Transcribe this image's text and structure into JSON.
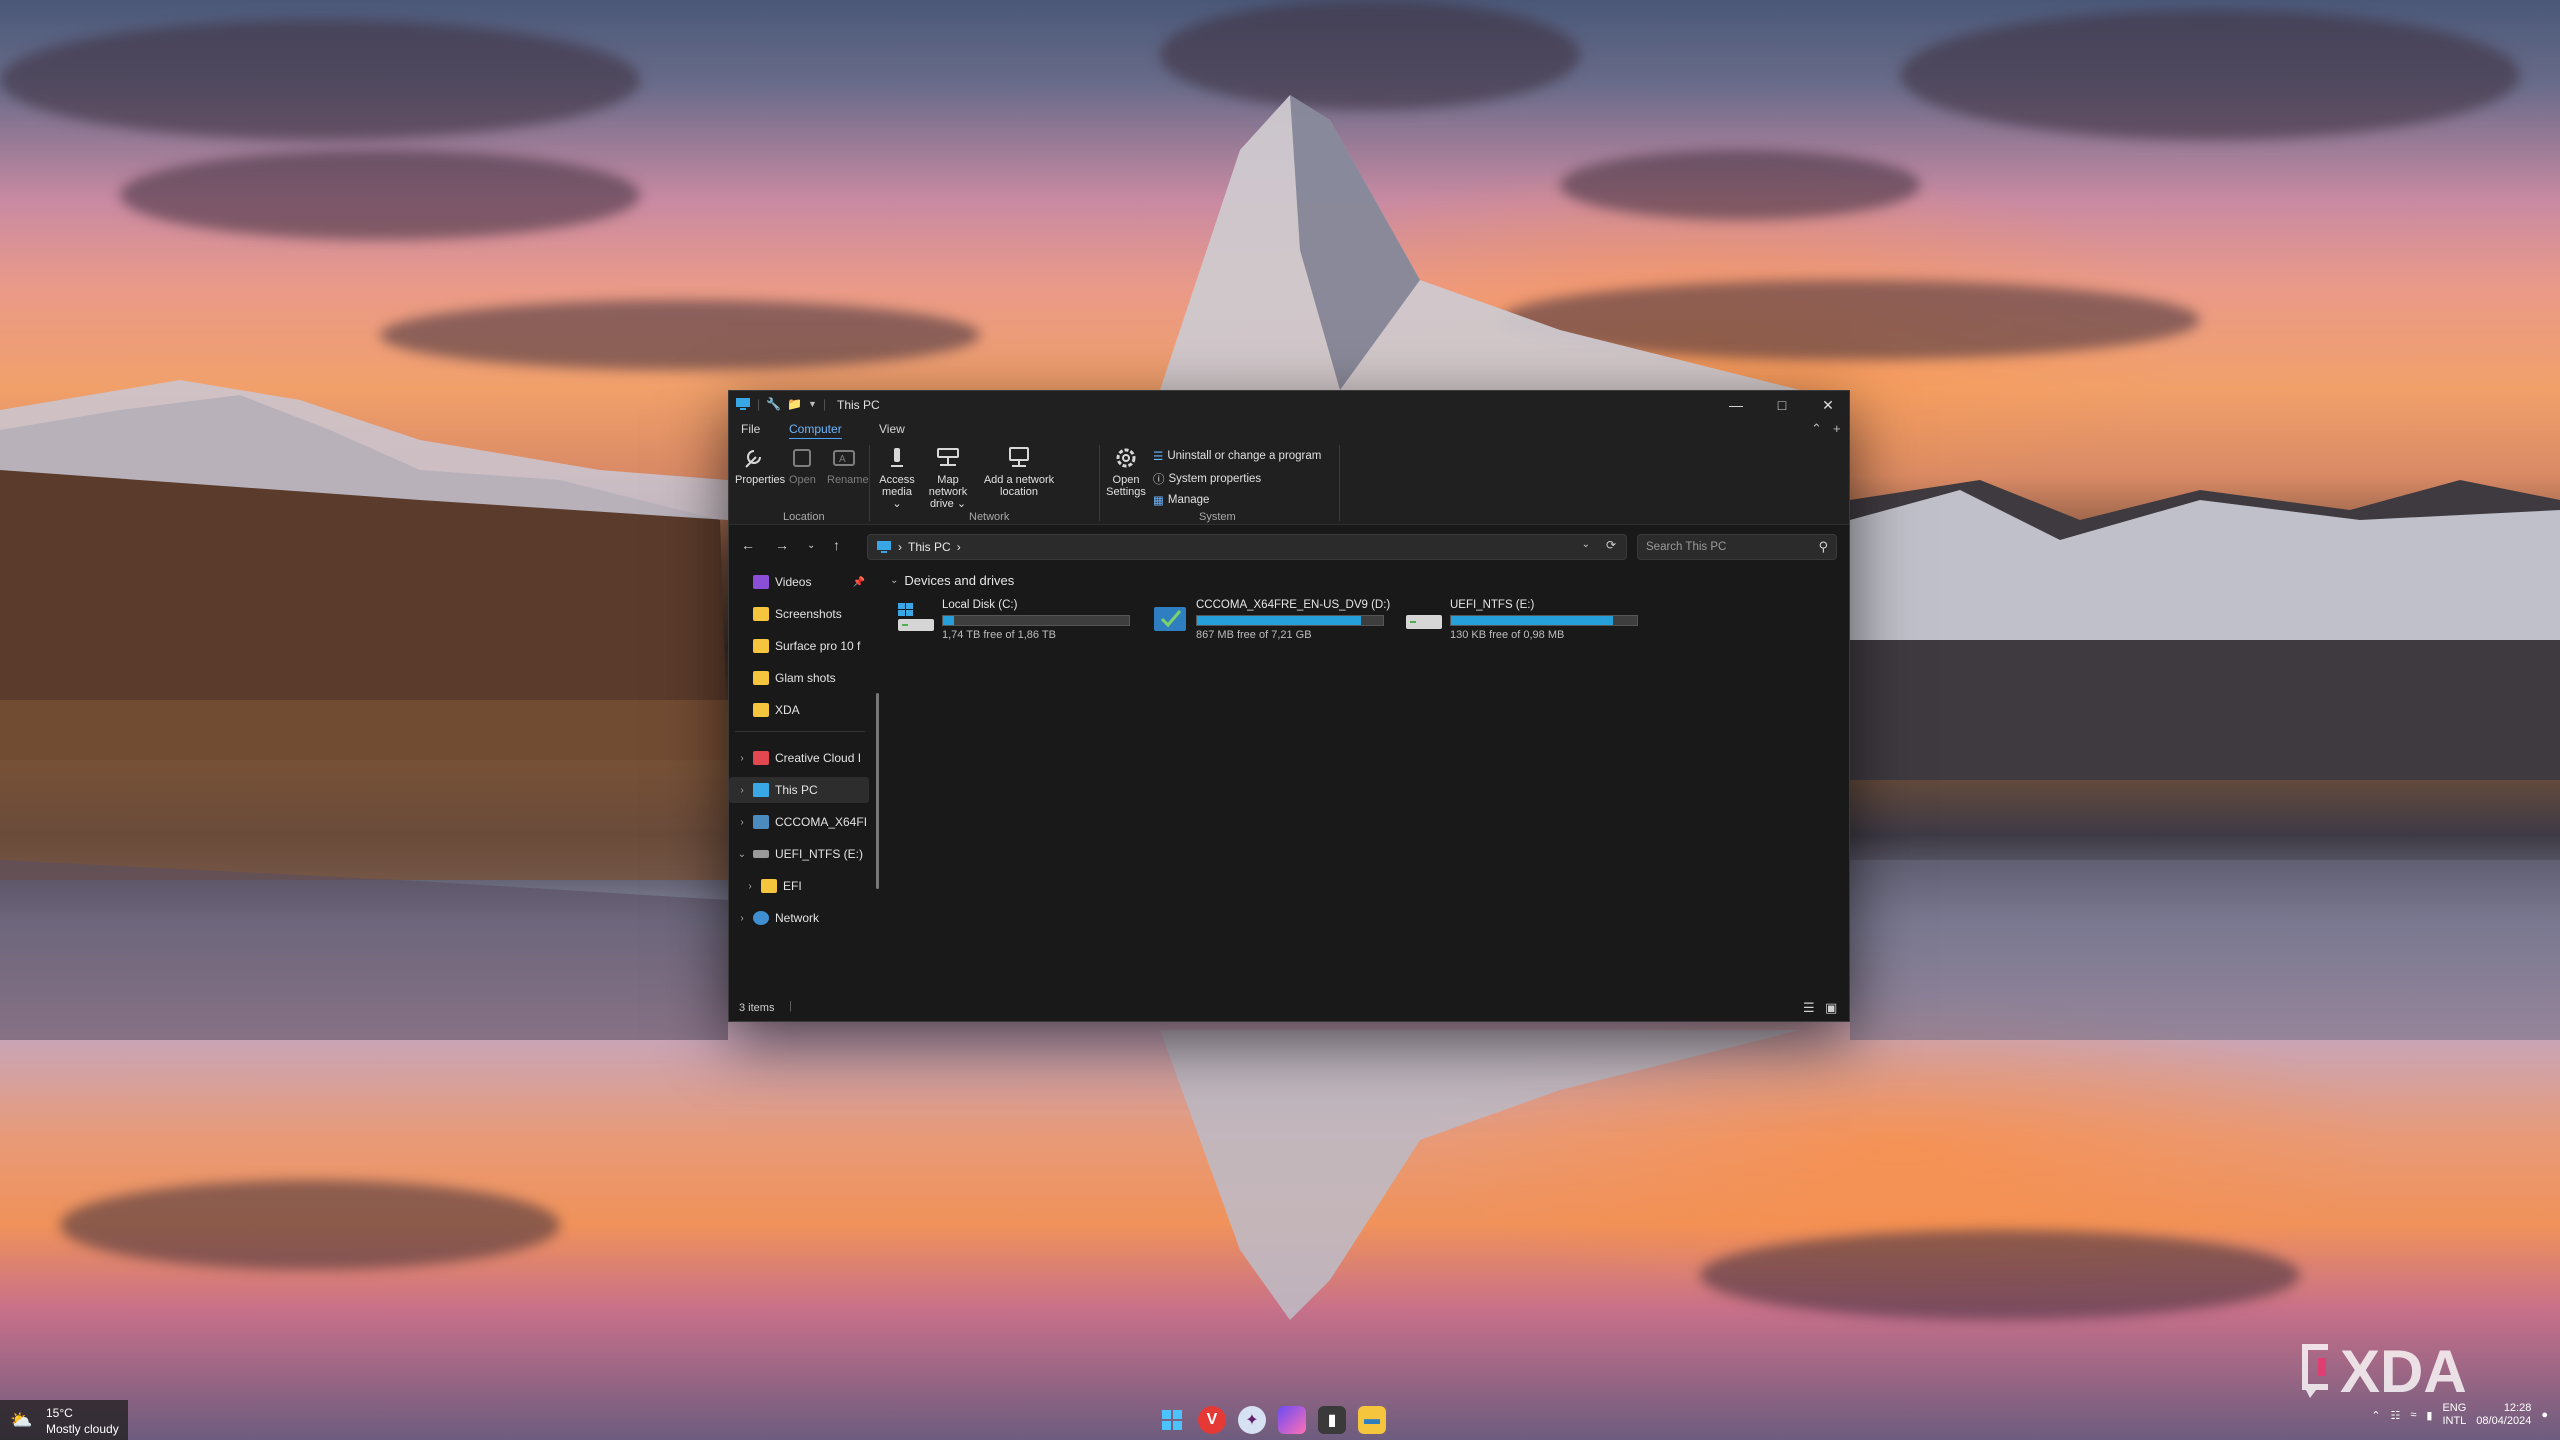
{
  "window": {
    "title": "This PC",
    "menu_tabs": [
      "File",
      "Computer",
      "View"
    ],
    "active_tab": "Computer"
  },
  "ribbon": {
    "location": {
      "group": "Location",
      "properties": "Properties",
      "open": "Open",
      "rename": "Rename"
    },
    "network": {
      "group": "Network",
      "access_media_1": "Access",
      "access_media_2": "media ⌄",
      "map_drive_1": "Map network",
      "map_drive_2": "drive ⌄",
      "add_location_1": "Add a network",
      "add_location_2": "location"
    },
    "system": {
      "group": "System",
      "open_settings_1": "Open",
      "open_settings_2": "Settings",
      "uninstall": "Uninstall or change a program",
      "system_properties": "System properties",
      "manage": "Manage"
    }
  },
  "address": {
    "path": "This PC",
    "search_placeholder": "Search This PC"
  },
  "sidebar": {
    "videos": "Videos",
    "screenshots": "Screenshots",
    "surface": "Surface pro 10 f",
    "glam": "Glam shots",
    "xda": "XDA",
    "creative_cloud": "Creative Cloud I",
    "this_pc": "This PC",
    "cccoma": "CCCOMA_X64FI",
    "uefi": "UEFI_NTFS (E:)",
    "efi": "EFI",
    "network": "Network"
  },
  "content": {
    "group_title": "Devices and drives",
    "drives": [
      {
        "name": "Local Disk (C:)",
        "free": "1,74 TB free of 1,86 TB",
        "used_fraction": 0.06
      },
      {
        "name": "CCCOMA_X64FRE_EN-US_DV9 (D:)",
        "free": "867 MB free of 7,21 GB",
        "used_fraction": 0.88
      },
      {
        "name": "UEFI_NTFS (E:)",
        "free": "130 KB free of 0,98 MB",
        "used_fraction": 0.87
      }
    ]
  },
  "status": {
    "items": "3 items"
  },
  "taskbar": {
    "temperature": "15°C",
    "weather": "Mostly cloudy",
    "lang_1": "ENG",
    "lang_2": "INTL",
    "time": "12:28",
    "date": "08/04/2024"
  },
  "watermark": "XDA",
  "colors": {
    "accent": "#26a0da",
    "folder": "#f4c53d",
    "window_bg": "#191919"
  }
}
